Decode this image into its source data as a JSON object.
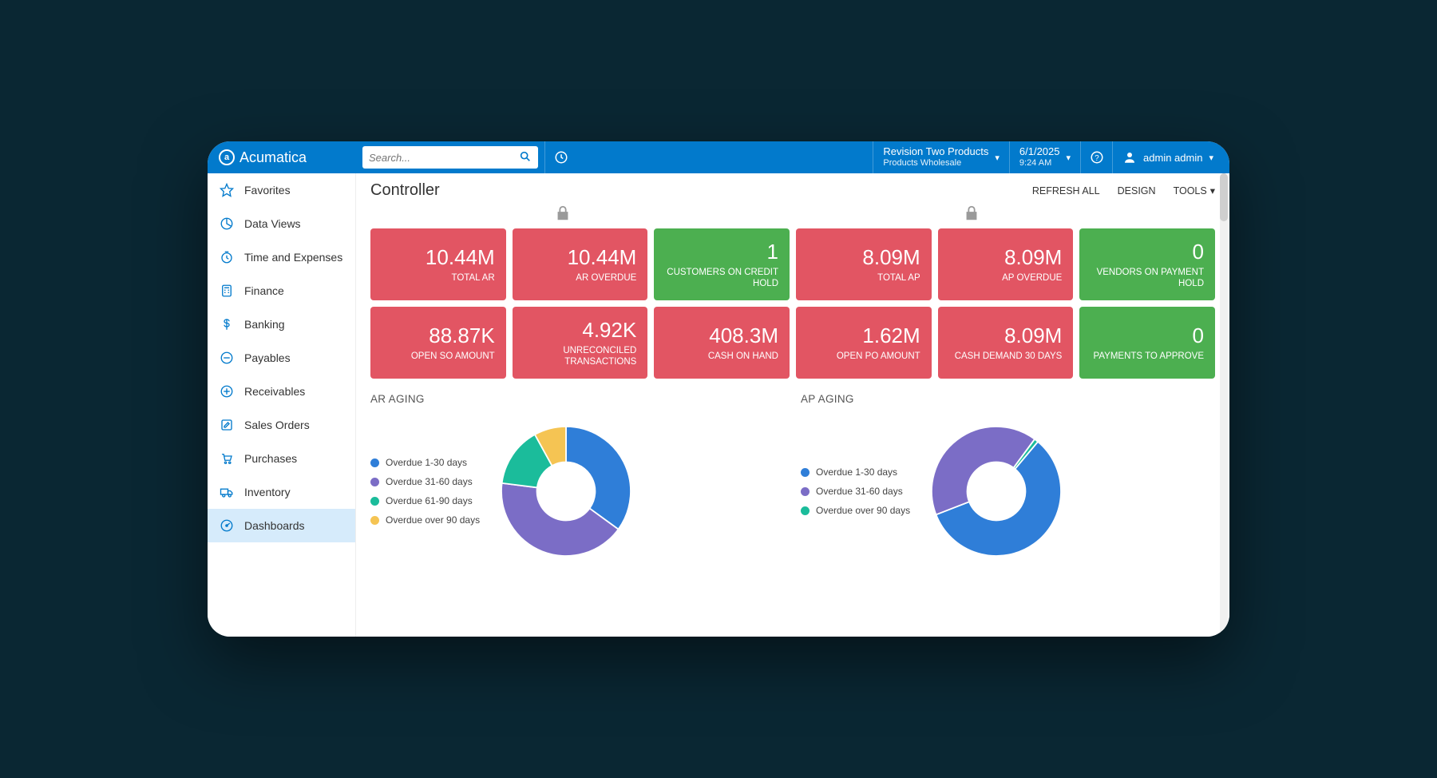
{
  "brand": "Acumatica",
  "search_placeholder": "Search...",
  "company": {
    "line1": "Revision Two Products",
    "line2": "Products Wholesale"
  },
  "datetime": {
    "date": "6/1/2025",
    "time": "9:24 AM"
  },
  "user": "admin admin",
  "page_title": "Controller",
  "actions": {
    "refresh": "REFRESH ALL",
    "design": "DESIGN",
    "tools": "TOOLS"
  },
  "sidebar": [
    {
      "icon": "star",
      "label": "Favorites"
    },
    {
      "icon": "pie",
      "label": "Data Views"
    },
    {
      "icon": "clock",
      "label": "Time and Expenses"
    },
    {
      "icon": "calc",
      "label": "Finance"
    },
    {
      "icon": "dollar",
      "label": "Banking"
    },
    {
      "icon": "minus",
      "label": "Payables"
    },
    {
      "icon": "plus",
      "label": "Receivables"
    },
    {
      "icon": "pencil",
      "label": "Sales Orders"
    },
    {
      "icon": "cart",
      "label": "Purchases"
    },
    {
      "icon": "truck",
      "label": "Inventory"
    },
    {
      "icon": "gauge",
      "label": "Dashboards",
      "active": true
    }
  ],
  "kpis_row1": [
    {
      "value": "10.44M",
      "label": "TOTAL AR",
      "color": "red"
    },
    {
      "value": "10.44M",
      "label": "AR OVERDUE",
      "color": "red"
    },
    {
      "value": "1",
      "label": "CUSTOMERS ON CREDIT HOLD",
      "color": "green"
    },
    {
      "value": "8.09M",
      "label": "TOTAL AP",
      "color": "red"
    },
    {
      "value": "8.09M",
      "label": "AP OVERDUE",
      "color": "red"
    },
    {
      "value": "0",
      "label": "VENDORS ON PAYMENT HOLD",
      "color": "green"
    }
  ],
  "kpis_row2": [
    {
      "value": "88.87K",
      "label": "OPEN SO AMOUNT",
      "color": "red"
    },
    {
      "value": "4.92K",
      "label": "UNRECONCILED TRANSACTIONS",
      "color": "red"
    },
    {
      "value": "408.3M",
      "label": "CASH ON HAND",
      "color": "red"
    },
    {
      "value": "1.62M",
      "label": "OPEN PO AMOUNT",
      "color": "red"
    },
    {
      "value": "8.09M",
      "label": "CASH DEMAND 30 DAYS",
      "color": "red"
    },
    {
      "value": "0",
      "label": "PAYMENTS TO APPROVE",
      "color": "green"
    }
  ],
  "colors": {
    "blue": "#2f7ed8",
    "purple": "#7b6dc6",
    "teal": "#1bbc9b",
    "yellow": "#f5c453"
  },
  "ar_title": "AR AGING",
  "ap_title": "AP AGING",
  "ar_legend": [
    {
      "label": "Overdue 1-30 days",
      "color": "blue"
    },
    {
      "label": "Overdue 31-60 days",
      "color": "purple"
    },
    {
      "label": "Overdue 61-90 days",
      "color": "teal"
    },
    {
      "label": "Overdue over 90 days",
      "color": "yellow"
    }
  ],
  "ap_legend": [
    {
      "label": "Overdue 1-30 days",
      "color": "blue"
    },
    {
      "label": "Overdue 31-60 days",
      "color": "purple"
    },
    {
      "label": "Overdue over 90 days",
      "color": "teal"
    }
  ],
  "chart_data": [
    {
      "type": "pie",
      "title": "AR AGING",
      "series": [
        {
          "name": "Overdue 1-30 days",
          "value": 35,
          "color": "#2f7ed8"
        },
        {
          "name": "Overdue 31-60 days",
          "value": 42,
          "color": "#7b6dc6"
        },
        {
          "name": "Overdue 61-90 days",
          "value": 15,
          "color": "#1bbc9b"
        },
        {
          "name": "Overdue over 90 days",
          "value": 8,
          "color": "#f5c453"
        }
      ],
      "donut_hole": 0.45,
      "start_angle_deg": 0
    },
    {
      "type": "pie",
      "title": "AP AGING",
      "series": [
        {
          "name": "Overdue 1-30 days",
          "value": 58,
          "color": "#2f7ed8"
        },
        {
          "name": "Overdue 31-60 days",
          "value": 41,
          "color": "#7b6dc6"
        },
        {
          "name": "Overdue over 90 days",
          "value": 1,
          "color": "#1bbc9b"
        }
      ],
      "donut_hole": 0.45,
      "start_angle_deg": 40
    }
  ]
}
